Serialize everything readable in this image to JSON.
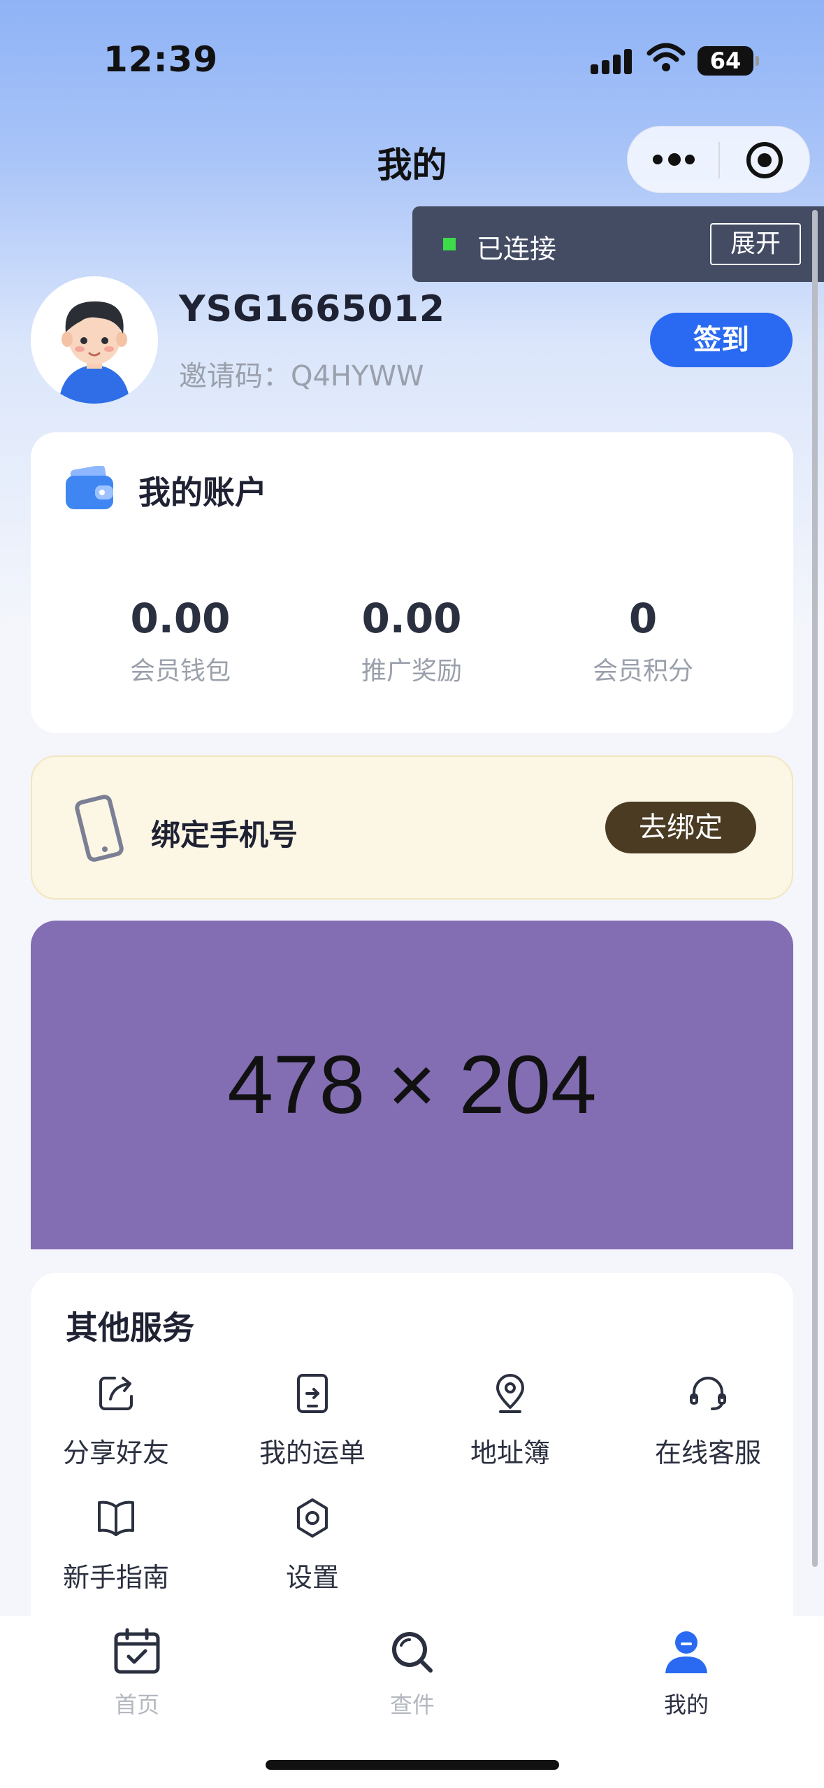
{
  "status_bar": {
    "time": "12:39",
    "battery": "64"
  },
  "header": {
    "title": "我的"
  },
  "connection": {
    "status": "已连接",
    "expand_label": "展开"
  },
  "profile": {
    "username": "YSG1665012",
    "invite_label": "邀请码：",
    "invite_code": "Q4HYWW",
    "checkin_label": "签到"
  },
  "account": {
    "title": "我的账户",
    "stats": [
      {
        "value": "0.00",
        "label": "会员钱包"
      },
      {
        "value": "0.00",
        "label": "推广奖励"
      },
      {
        "value": "0",
        "label": "会员积分"
      }
    ]
  },
  "bind_phone": {
    "title": "绑定手机号",
    "button": "去绑定"
  },
  "banner": {
    "text": "478 × 204"
  },
  "services": {
    "title": "其他服务",
    "items": [
      {
        "label": "分享好友",
        "icon": "share-icon"
      },
      {
        "label": "我的运单",
        "icon": "waybill-icon"
      },
      {
        "label": "地址簿",
        "icon": "location-icon"
      },
      {
        "label": "在线客服",
        "icon": "headset-icon"
      },
      {
        "label": "新手指南",
        "icon": "book-icon"
      },
      {
        "label": "设置",
        "icon": "gear-icon"
      }
    ]
  },
  "tabbar": {
    "items": [
      {
        "label": "首页",
        "icon": "calendar-check-icon"
      },
      {
        "label": "查件",
        "icon": "search-icon"
      },
      {
        "label": "我的",
        "icon": "user-icon"
      }
    ]
  },
  "colors": {
    "accent": "#2a6af2",
    "banner": "#836db3",
    "bind_bg": "#fcf6e4",
    "bind_button": "#4a3b22",
    "connected": "#3ddc4a"
  }
}
